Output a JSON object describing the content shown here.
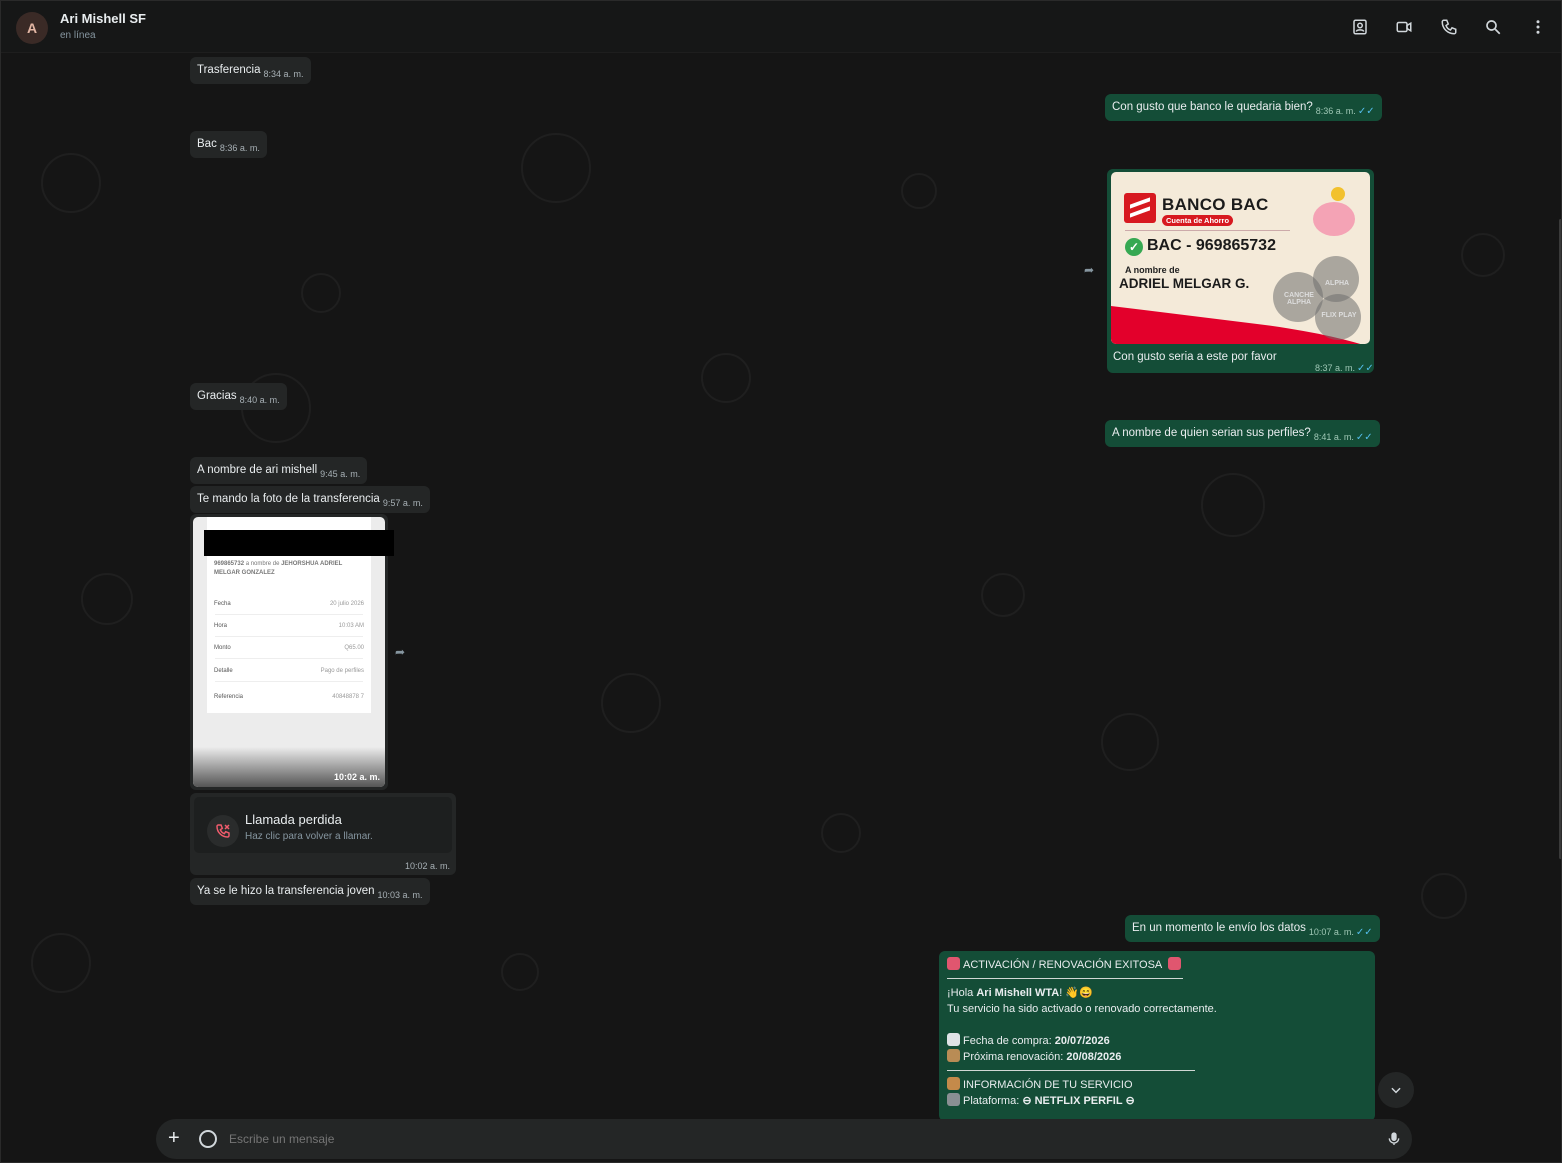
{
  "header": {
    "avatar_letter": "A",
    "contact_name": "Ari Mishell SF",
    "status": "en línea",
    "icons": [
      "contact-card-icon",
      "video-call-icon",
      "phone-icon",
      "search-icon",
      "more-vert-icon"
    ]
  },
  "messages": {
    "m1": {
      "text": "Trasferencia",
      "time": "8:34 a. m."
    },
    "m2": {
      "text": "Con gusto que banco le quedaria bien?",
      "time": "8:36 a. m."
    },
    "m3": {
      "text": "Bac",
      "time": "8:36 a. m."
    },
    "m4": {
      "caption": "Con gusto seria a este por favor",
      "time": "8:37 a. m."
    },
    "m5": {
      "text": "Gracias",
      "time": "8:40 a. m."
    },
    "m6": {
      "text": "A nombre de quien serian sus perfiles?",
      "time": "8:41 a. m."
    },
    "m7": {
      "text": "A nombre de ari mishell",
      "time": "9:45 a. m."
    },
    "m8": {
      "text": "Te mando la foto de la transferencia",
      "time": "9:57 a. m."
    },
    "m9": {
      "time": "10:02 a. m."
    },
    "m10": {
      "title": "Llamada perdida",
      "subtitle": "Haz clic para volver a llamar.",
      "time": "10:02 a. m."
    },
    "m11": {
      "text": "Ya se le hizo la transferencia joven",
      "time": "10:03 a. m."
    },
    "m12": {
      "text": "En un momento le envío los datos",
      "time": "10:07 a. m."
    }
  },
  "bac_image": {
    "bank": "BANCO BAC",
    "account_type": "Cuenta de Ahorro",
    "account": "BAC - 969865732",
    "a_nombre": "A nombre de",
    "holder": "ADRIEL MELGAR G.",
    "logo1": "CANCHE ALPHA",
    "logo2": "ALPHA",
    "logo3": "FLIX PLAY"
  },
  "receipt": {
    "account_line": "969865732",
    "a_nombre_de": "a nombre de",
    "name_line1": "JEHORSHUA ADRIEL",
    "name_line2": "MELGAR GONZALEZ",
    "rows": [
      {
        "label": "Fecha",
        "value": "20 julio 2026"
      },
      {
        "label": "Hora",
        "value": "10:03 AM"
      },
      {
        "label": "Monto",
        "value": "Q65.00"
      },
      {
        "label": "Detalle",
        "value": "Pago de perfiles"
      },
      {
        "label": "Referencia",
        "value": "40848878 7"
      }
    ]
  },
  "activation": {
    "title": "ACTIVACIÓN / RENOVACIÓN EXITOSA",
    "greeting_pre": "¡Hola ",
    "greeting_name": "Ari Mishell WTA",
    "greeting_post": "! 👋😄",
    "line2": "Tu servicio ha sido activado o renovado correctamente.",
    "purchase_label": "Fecha de compra: ",
    "purchase_date": "20/07/2026",
    "renewal_label": "Próxima renovación: ",
    "renewal_date": "20/08/2026",
    "info_title": "INFORMACIÓN DE TU SERVICIO",
    "platform_label": "Plataforma: ",
    "platform_value": "⊖ NETFLIX PERFIL ⊖"
  },
  "composer": {
    "placeholder": "Escribe un mensaje"
  },
  "colors": {
    "incoming_bubble": "#242626",
    "outgoing_bubble": "#144d37",
    "read_ticks": "#53bdeb",
    "missed_call": "#f15c6d"
  }
}
